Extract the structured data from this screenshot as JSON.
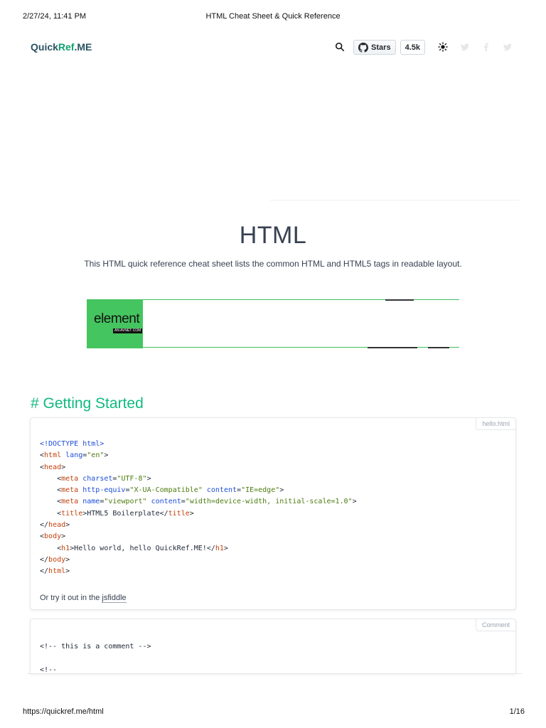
{
  "print": {
    "datetime": "2/27/24, 11:41 PM",
    "doc_title": "HTML Cheat Sheet & Quick Reference",
    "url": "https://quickref.me/html",
    "page_number": "1/16"
  },
  "nav": {
    "logo_prefix": "Quick",
    "logo_accent": "Ref",
    "logo_suffix": ".ME",
    "github_label": "Stars",
    "github_count": "4.5k",
    "icons": [
      "search-icon",
      "github-icon",
      "theme-toggle-icon",
      "twitter-icon",
      "facebook-icon",
      "twitter-icon"
    ]
  },
  "hero": {
    "title": "HTML",
    "description": "This HTML quick reference cheat sheet lists the common HTML and HTML5 tags in readable layout."
  },
  "ad": {
    "brand": "element",
    "tagline": "AN AVNET COM"
  },
  "section": {
    "heading": "# Getting Started"
  },
  "cards": [
    {
      "label": "hello.html",
      "code_lines": [
        [
          [
            "kw",
            "<!DOCTYPE html>"
          ]
        ],
        [
          [
            "plain",
            "<"
          ],
          [
            "tag",
            "html"
          ],
          [
            "plain",
            " "
          ],
          [
            "attr",
            "lang"
          ],
          [
            "plain",
            "="
          ],
          [
            "str",
            "\"en\""
          ],
          [
            "plain",
            ">"
          ]
        ],
        [
          [
            "plain",
            "<"
          ],
          [
            "tag",
            "head"
          ],
          [
            "plain",
            ">"
          ]
        ],
        [
          [
            "plain",
            "    <"
          ],
          [
            "tag",
            "meta"
          ],
          [
            "plain",
            " "
          ],
          [
            "attr",
            "charset"
          ],
          [
            "plain",
            "="
          ],
          [
            "str",
            "\"UTF-8\""
          ],
          [
            "plain",
            ">"
          ]
        ],
        [
          [
            "plain",
            "    <"
          ],
          [
            "tag",
            "meta"
          ],
          [
            "plain",
            " "
          ],
          [
            "attr",
            "http-equiv"
          ],
          [
            "plain",
            "="
          ],
          [
            "str",
            "\"X-UA-Compatible\""
          ],
          [
            "plain",
            " "
          ],
          [
            "attr",
            "content"
          ],
          [
            "plain",
            "="
          ],
          [
            "str",
            "\"IE=edge\""
          ],
          [
            "plain",
            ">"
          ]
        ],
        [
          [
            "plain",
            "    <"
          ],
          [
            "tag",
            "meta"
          ],
          [
            "plain",
            " "
          ],
          [
            "attr",
            "name"
          ],
          [
            "plain",
            "="
          ],
          [
            "str",
            "\"viewport\""
          ],
          [
            "plain",
            " "
          ],
          [
            "attr",
            "content"
          ],
          [
            "plain",
            "="
          ],
          [
            "str",
            "\"width=device-width, initial-scale=1.0\""
          ],
          [
            "plain",
            ">"
          ]
        ],
        [
          [
            "plain",
            "    <"
          ],
          [
            "tag",
            "title"
          ],
          [
            "plain",
            ">HTML5 Boilerplate</"
          ],
          [
            "tag",
            "title"
          ],
          [
            "plain",
            ">"
          ]
        ],
        [
          [
            "plain",
            "</"
          ],
          [
            "tag",
            "head"
          ],
          [
            "plain",
            ">"
          ]
        ],
        [
          [
            "plain",
            "<"
          ],
          [
            "tag",
            "body"
          ],
          [
            "plain",
            ">"
          ]
        ],
        [
          [
            "plain",
            "    <"
          ],
          [
            "tag",
            "h1"
          ],
          [
            "plain",
            ">Hello world, hello QuickRef.ME!</"
          ],
          [
            "tag",
            "h1"
          ],
          [
            "plain",
            ">"
          ]
        ],
        [
          [
            "plain",
            "</"
          ],
          [
            "tag",
            "body"
          ],
          [
            "plain",
            ">"
          ]
        ],
        [
          [
            "plain",
            "</"
          ],
          [
            "tag",
            "html"
          ],
          [
            "plain",
            ">"
          ]
        ]
      ],
      "note_text": "Or try it out in the ",
      "note_link": "jsfiddle"
    },
    {
      "label": "Comment",
      "code_lines": [
        [
          [
            "cmt",
            "<!-- this is a comment -->"
          ]
        ],
        [
          [
            "cmt",
            ""
          ]
        ],
        [
          [
            "cmt",
            "<!--"
          ]
        ]
      ]
    }
  ],
  "colors": {
    "accent": "#10b981",
    "logo": "#2c5364",
    "tag": "#c2410c",
    "attr": "#1d4ed8",
    "string": "#4d7c0f"
  }
}
